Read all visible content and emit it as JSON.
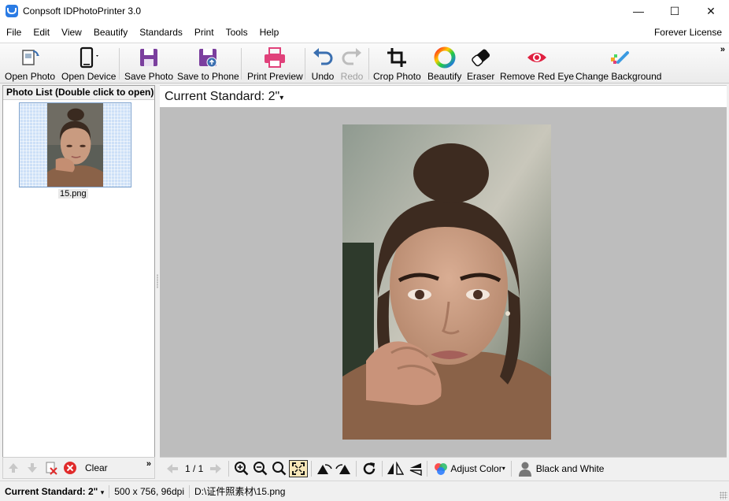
{
  "window": {
    "title": "Conpsoft IDPhotoPrinter 3.0",
    "minimize": "—",
    "maximize": "☐",
    "close": "✕"
  },
  "menu": {
    "items": [
      "File",
      "Edit",
      "View",
      "Beautify",
      "Standards",
      "Print",
      "Tools",
      "Help"
    ],
    "license": "Forever License"
  },
  "toolbar": {
    "open_photo": "Open Photo",
    "open_device": "Open Device",
    "save_photo": "Save Photo",
    "save_to_phone": "Save to Phone",
    "print_preview": "Print Preview",
    "undo": "Undo",
    "redo": "Redo",
    "crop_photo": "Crop Photo",
    "beautify": "Beautify",
    "eraser": "Eraser",
    "remove_red_eye": "Remove Red Eye",
    "change_background": "Change Background",
    "overflow": "»"
  },
  "photo_list": {
    "header": "Photo List (Double click to open)",
    "items": [
      {
        "name": "15.png"
      }
    ],
    "clear": "Clear",
    "overflow": "»"
  },
  "standard": {
    "label": "Current Standard: 2\"",
    "caret": "▾"
  },
  "viewer": {
    "page": "1 / 1",
    "adjust_color": "Adjust Color",
    "black_and_white": "Black and White"
  },
  "status": {
    "standard": "Current Standard: 2\"",
    "info": "500 x 756, 96dpi",
    "path": "D:\\证件照素材\\15.png"
  },
  "colors": {
    "accent": "#2a7be4",
    "save": "#7b3f9e",
    "print": "#e0417a",
    "undo": "#3a6fb0",
    "red_eye": "#e02040",
    "delete": "#e02b2b",
    "canvas_bg": "#bdbdbd"
  }
}
